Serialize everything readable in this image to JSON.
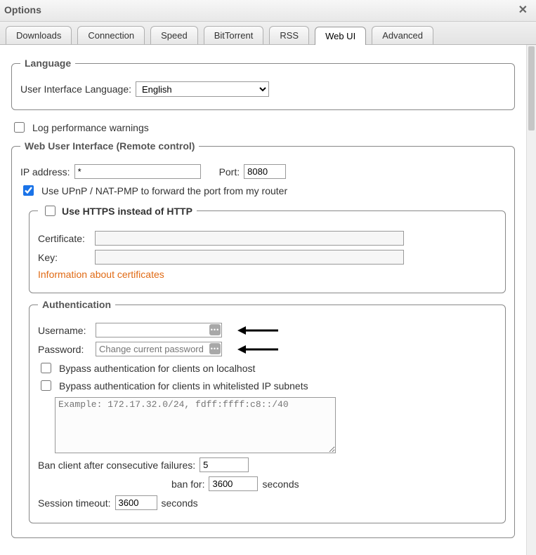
{
  "window_title": "Options",
  "tabs": [
    "Downloads",
    "Connection",
    "Speed",
    "BitTorrent",
    "RSS",
    "Web UI",
    "Advanced"
  ],
  "active_tab": "Web UI",
  "language": {
    "legend": "Language",
    "label": "User Interface Language:",
    "value": "English",
    "options": [
      "English"
    ]
  },
  "log_perf": {
    "label": "Log performance warnings",
    "checked": false
  },
  "webui": {
    "legend": "Web User Interface (Remote control)",
    "ip_label": "IP address:",
    "ip_value": "*",
    "port_label": "Port:",
    "port_value": "8080",
    "upnp": {
      "label": "Use UPnP / NAT-PMP to forward the port from my router",
      "checked": true
    },
    "https": {
      "legend": "Use HTTPS instead of HTTP",
      "checked": false,
      "cert_label": "Certificate:",
      "cert_value": "",
      "key_label": "Key:",
      "key_value": "",
      "info_link": "Information about certificates"
    },
    "auth": {
      "legend": "Authentication",
      "username_label": "Username:",
      "username_value": "",
      "password_label": "Password:",
      "password_placeholder": "Change current password",
      "bypass_localhost": {
        "label": "Bypass authentication for clients on localhost",
        "checked": false
      },
      "bypass_whitelist": {
        "label": "Bypass authentication for clients in whitelisted IP subnets",
        "checked": false
      },
      "whitelist_placeholder": "Example: 172.17.32.0/24, fdff:ffff:c8::/40",
      "ban_fail_label": "Ban client after consecutive failures:",
      "ban_fail_value": "5",
      "ban_for_label": "ban for:",
      "ban_for_value": "3600",
      "seconds": "seconds",
      "session_timeout_label": "Session timeout:",
      "session_timeout_value": "3600"
    }
  }
}
